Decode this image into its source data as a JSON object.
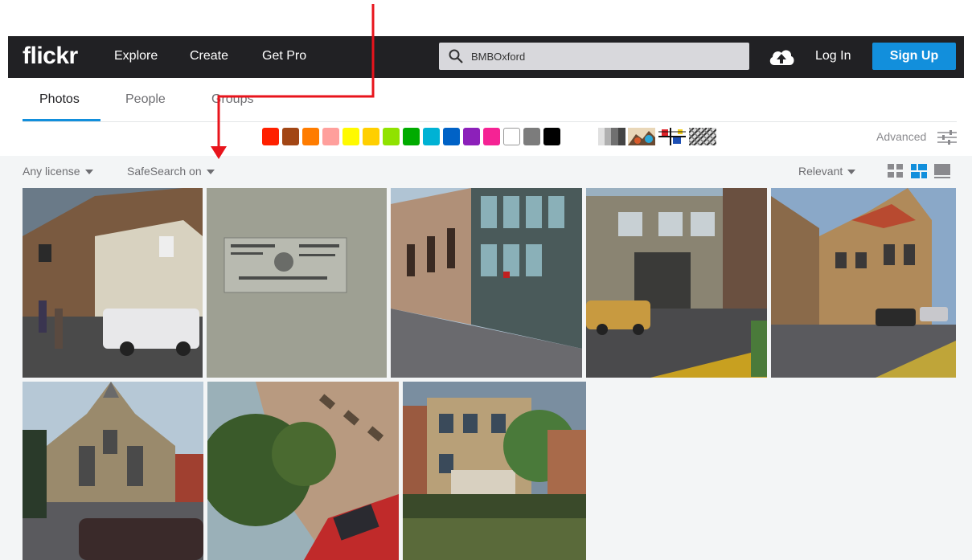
{
  "nav": {
    "logo": "flickr",
    "links": [
      "Explore",
      "Create",
      "Get Pro"
    ],
    "search_value": "BMBOxford",
    "login": "Log In",
    "signup": "Sign Up"
  },
  "subnav": {
    "tabs": [
      "Photos",
      "People",
      "Groups"
    ],
    "active": "Photos"
  },
  "colors": [
    "#ff2000",
    "#a24615",
    "#ff7c00",
    "#ff9f9c",
    "#fffa00",
    "#ffcf00",
    "#90e200",
    "#00ab00",
    "#00b2d4",
    "#0062c6",
    "#8c20ba",
    "#f52394",
    "#ffffff",
    "#7c7c7c",
    "#000000"
  ],
  "advanced_label": "Advanced",
  "filters": {
    "license": "Any license",
    "safesearch": "SafeSearch on",
    "sort": "Relevant"
  },
  "accent_color": "#128fdc",
  "icons": [
    "search-icon",
    "upload-cloud-icon",
    "filter-sliders-icon",
    "grid-view-icon",
    "justified-view-icon",
    "large-view-icon"
  ]
}
